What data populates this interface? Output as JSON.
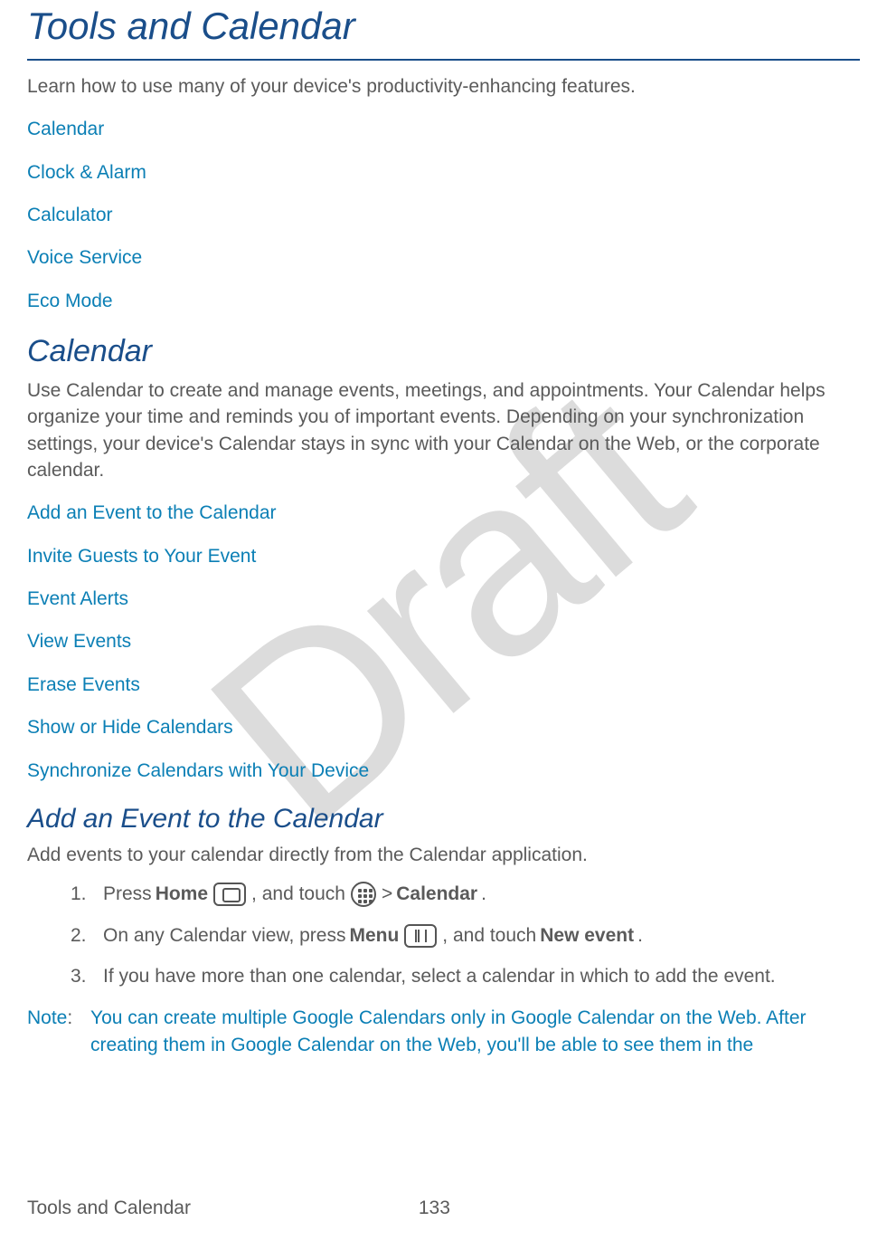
{
  "watermark": "Draft",
  "title": "Tools and Calendar",
  "intro": "Learn how to use many of your device's productivity-enhancing features.",
  "toc1": [
    "Calendar",
    "Clock & Alarm",
    "Calculator",
    "Voice Service",
    "Eco Mode"
  ],
  "section_calendar": {
    "heading": "Calendar",
    "body": "Use Calendar to create and manage events, meetings, and appointments. Your Calendar helps organize your time and reminds you of important events. Depending on your synchronization settings, your device's Calendar stays in sync with your Calendar on the Web, or the corporate calendar.",
    "links": [
      "Add an Event to the Calendar",
      "Invite Guests to Your Event",
      "Event Alerts",
      "View Events",
      "Erase Events",
      "Show or Hide Calendars",
      "Synchronize Calendars with Your Device"
    ]
  },
  "section_add_event": {
    "heading": "Add an Event to the Calendar",
    "body": "Add events to your calendar directly from the Calendar application.",
    "step1": {
      "num": "1.",
      "a": "Press ",
      "b1": "Home",
      "c": ", and touch ",
      "gt": " > ",
      "b2": "Calendar",
      "end": "."
    },
    "step2": {
      "num": "2.",
      "a": "On any Calendar view, press ",
      "b1": "Menu",
      "c": ", and touch ",
      "b2": "New event",
      "end": "."
    },
    "step3": {
      "num": "3.",
      "a": "If you have more than one calendar, select a calendar in which to add the event."
    }
  },
  "note": {
    "label": "Note",
    "colon": ":",
    "body": "You can create multiple Google Calendars only in Google Calendar on the Web. After creating them in Google Calendar on the Web, you'll be able to see them in the"
  },
  "footer": {
    "section": "Tools and Calendar",
    "page": "133"
  }
}
